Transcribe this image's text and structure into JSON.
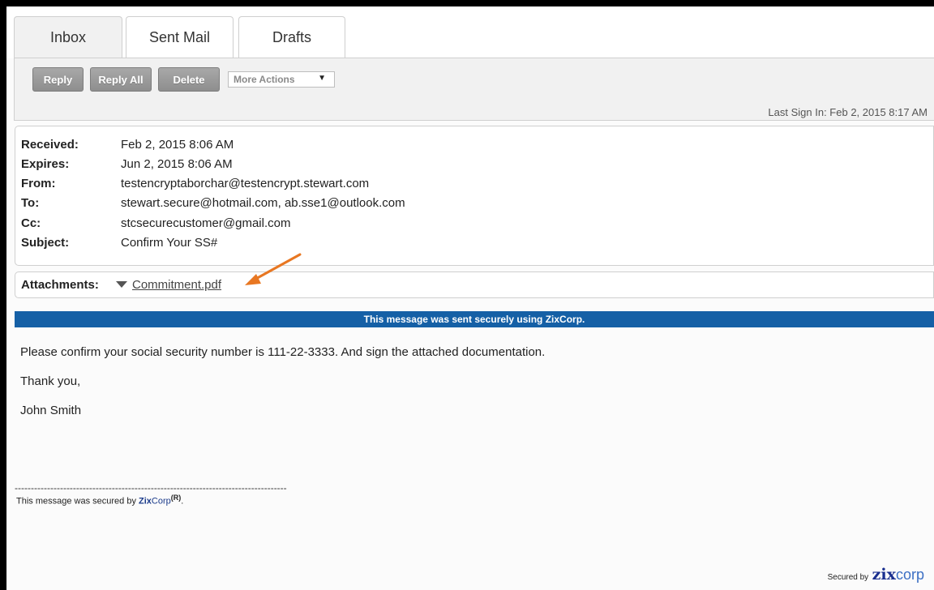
{
  "tabs": [
    {
      "label": "Inbox",
      "active": true
    },
    {
      "label": "Sent Mail",
      "active": false
    },
    {
      "label": "Drafts",
      "active": false
    }
  ],
  "toolbar": {
    "reply_label": "Reply",
    "reply_all_label": "Reply All",
    "delete_label": "Delete",
    "more_actions_label": "More Actions",
    "last_sign_in": "Last Sign In: Feb 2, 2015 8:17 AM"
  },
  "message": {
    "headers": [
      {
        "label": "Received:",
        "value": "Feb 2, 2015 8:06 AM"
      },
      {
        "label": "Expires:",
        "value": "Jun 2, 2015 8:06 AM"
      },
      {
        "label": "From:",
        "value": "testencryptaborchar@testencrypt.stewart.com"
      },
      {
        "label": "To:",
        "value": "stewart.secure@hotmail.com, ab.sse1@outlook.com"
      },
      {
        "label": "Cc:",
        "value": "stcsecurecustomer@gmail.com"
      },
      {
        "label": "Subject:",
        "value": "Confirm Your SS#"
      }
    ],
    "attachments_label": "Attachments:",
    "attachment_file": "Commitment.pdf",
    "banner": "This message was sent securely using ZixCorp.",
    "body": [
      "Please confirm your social security number is 111-22-3333.  And sign the attached documentation.",
      "Thank you,",
      "John Smith"
    ],
    "footer_dashes": "------------------------------------------------------------------------------------",
    "footer_prefix": "This message was secured by ",
    "footer_brand_bold": "Zix",
    "footer_brand_rest": "Corp",
    "footer_sup": "(R)",
    "footer_suffix": "."
  },
  "footer_logo": {
    "secured_by": "Secured by",
    "zix": "zix",
    "corp": "corp"
  },
  "colors": {
    "banner": "#1560a6",
    "arrow": "#e87722",
    "brand_blue": "#1a3a8a"
  }
}
